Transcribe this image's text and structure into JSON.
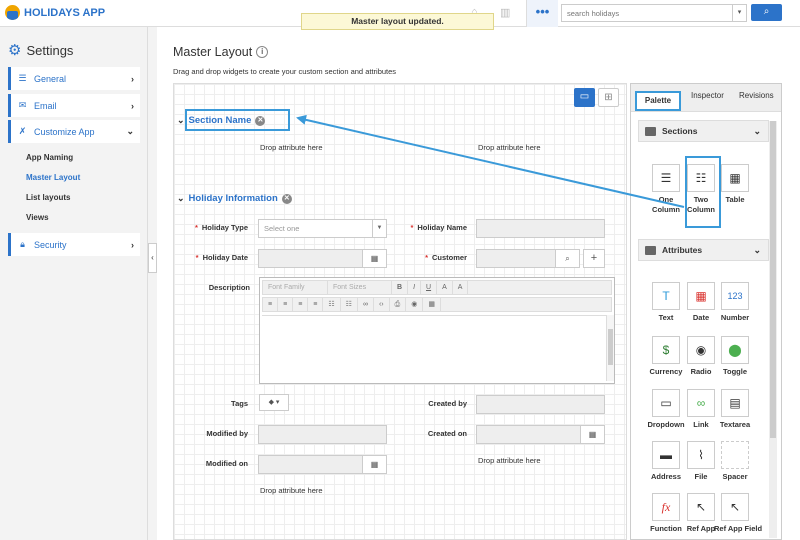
{
  "app": {
    "title": "HOLIDAYS APP"
  },
  "toast": "Master layout updated.",
  "search": {
    "placeholder": "search holidays"
  },
  "sidebar": {
    "heading": "Settings",
    "items": [
      {
        "label": "General",
        "icon": "sliders-icon"
      },
      {
        "label": "Email",
        "icon": "envelope-icon"
      },
      {
        "label": "Customize App",
        "icon": "wrench-icon"
      },
      {
        "label": "Security",
        "icon": "lock-icon"
      }
    ],
    "sub_items": [
      "App Naming",
      "Master Layout",
      "List layouts",
      "Views"
    ],
    "active_sub": "Master Layout"
  },
  "main": {
    "title": "Master Layout",
    "subtitle": "Drag and drop widgets to create your custom section and attributes",
    "section1": {
      "title": "Section Name",
      "drop_left": "Drop attribute here",
      "drop_right": "Drop attribute here"
    },
    "section2": {
      "title": "Holiday Information",
      "holiday_type": {
        "label": "Holiday Type",
        "placeholder": "Select one"
      },
      "holiday_name": {
        "label": "Holiday Name"
      },
      "holiday_date": {
        "label": "Holiday Date"
      },
      "customer": {
        "label": "Customer"
      },
      "description": {
        "label": "Description"
      },
      "editor": {
        "font_family": "Font Family",
        "font_sizes": "Font Sizes"
      },
      "tags": {
        "label": "Tags"
      },
      "created_by": {
        "label": "Created by"
      },
      "modified_by": {
        "label": "Modified by"
      },
      "created_on": {
        "label": "Created on"
      },
      "modified_on": {
        "label": "Modified on"
      },
      "drop_right": "Drop attribute here",
      "drop_bottom": "Drop attribute here"
    }
  },
  "panel": {
    "tabs": [
      "Palette",
      "Inspector",
      "Revisions"
    ],
    "sections_heading": "Sections",
    "section_tiles": [
      "One Column",
      "Two Column",
      "Table"
    ],
    "attributes_heading": "Attributes",
    "attribute_tiles": [
      "Text",
      "Date",
      "Number",
      "Currency",
      "Radio",
      "Toggle",
      "Dropdown",
      "Link",
      "Textarea",
      "Address",
      "File",
      "Spacer",
      "Function",
      "Ref App",
      "Ref App Field"
    ]
  },
  "colors": {
    "accent": "#2c73c9",
    "highlight": "#3a9ad9",
    "required": "#d9302c",
    "toast_bg": "#fcf8d6"
  }
}
